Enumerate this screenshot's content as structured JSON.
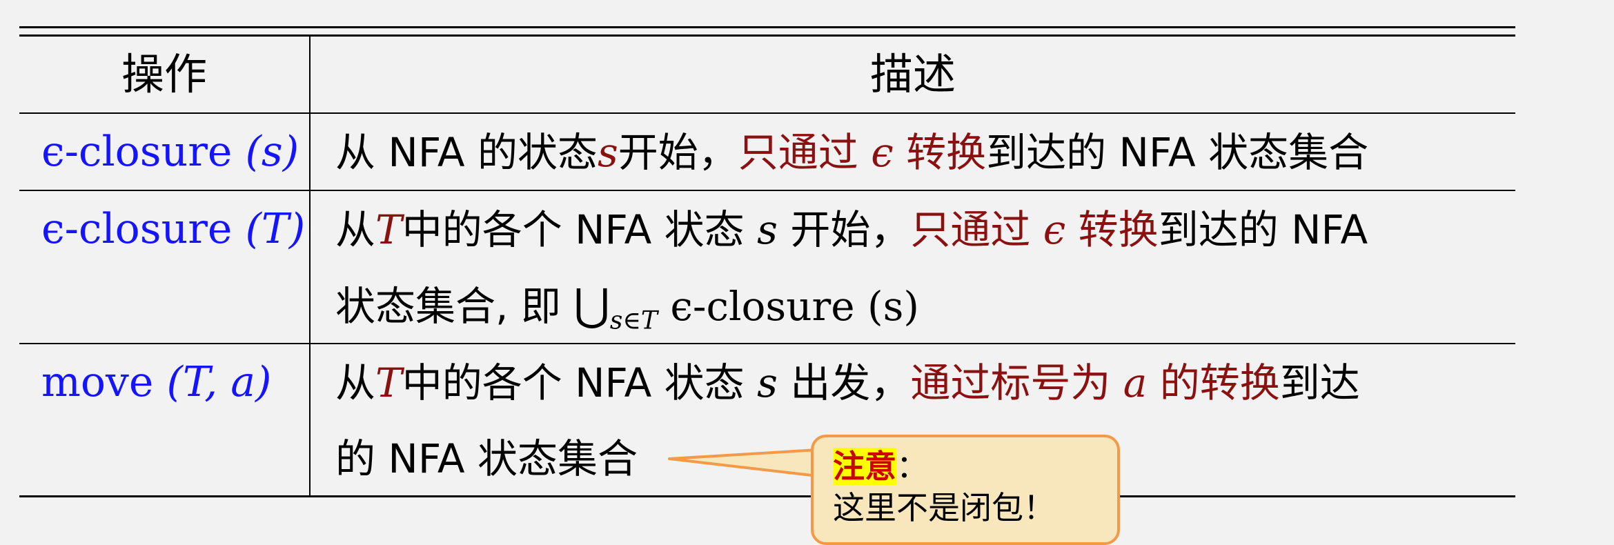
{
  "table": {
    "headers": {
      "operation": "操作",
      "description": "描述"
    },
    "rows": [
      {
        "op_fn": "ϵ-closure",
        "op_args": "(s)",
        "desc": {
          "a": "从 NFA 的状态",
          "b": "s",
          "c": "开始，",
          "d": "只通过 ",
          "e": "ϵ",
          "f": " 转换",
          "g": "到达的 NFA 状态集合"
        }
      },
      {
        "op_fn": "ϵ-closure",
        "op_args": "(T)",
        "desc": {
          "a": "从",
          "b": "T",
          "c": "中的各个 NFA 状态 ",
          "d": "s",
          "e": " 开始，",
          "f": "只通过 ",
          "g": "ϵ",
          "h": " 转换",
          "i": "到达的 NFA",
          "line2_a": "状态集合, 即 ",
          "union": "⋃",
          "sub": "s∈T",
          "line2_b": " ϵ-closure (s)"
        }
      },
      {
        "op_fn": "move",
        "op_args": "(T, a)",
        "desc": {
          "a": "从",
          "b": "T",
          "c": "中的各个 NFA 状态 ",
          "d": "s",
          "e": " 出发，",
          "f": "通过标号为 ",
          "g": "a",
          "h": " 的转换",
          "i": "到达",
          "line2": "的 NFA 状态集合"
        }
      }
    ]
  },
  "callout": {
    "label": "注意",
    "colon": "：",
    "text": "这里不是闭包！"
  },
  "colors": {
    "op_blue": "#1414ff",
    "emphasis_red": "#8b1010",
    "callout_bg": "#f8e6bd",
    "callout_border": "#f29a47",
    "highlight": "#ffff00"
  }
}
